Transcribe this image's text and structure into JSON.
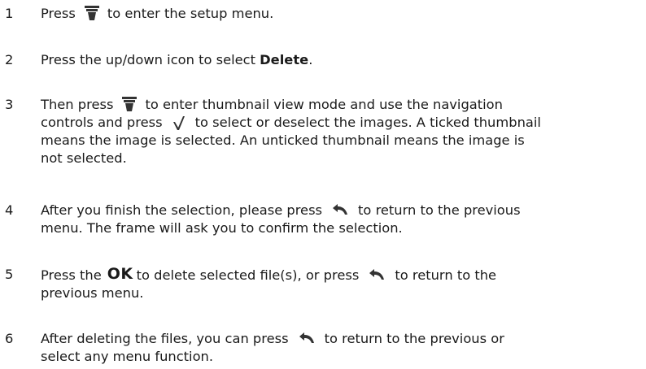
{
  "steps": [
    {
      "num": "1",
      "parts": [
        "Press",
        "to enter the setup menu."
      ]
    },
    {
      "num": "2",
      "pre": "Press the up/down icon to select ",
      "bold": "Delete",
      "post": "."
    },
    {
      "num": "3",
      "a": "Then press",
      "b": "to enter thumbnail view mode and use the navigation",
      "c": "controls and press",
      "d": "to select or deselect the images. A ticked thumbnail",
      "e": "means the image is selected. An unticked thumbnail means the image is",
      "f": "not selected."
    },
    {
      "num": "4",
      "a": "After you finish the selection, please press",
      "b": "to return to the previous",
      "c": "menu. The frame will ask you to confirm the selection."
    },
    {
      "num": "5",
      "a": "Press the",
      "ok": "OK",
      "b": "to delete selected file(s), or press",
      "c": "to return to the",
      "d": "previous menu."
    },
    {
      "num": "6",
      "a": "After deleting the files, you can press",
      "b": "to return to the previous or",
      "c": "select any menu function."
    }
  ],
  "icons": {
    "setup": "setup-menu-icon",
    "check": "check-icon",
    "back": "back-arrow-icon"
  }
}
